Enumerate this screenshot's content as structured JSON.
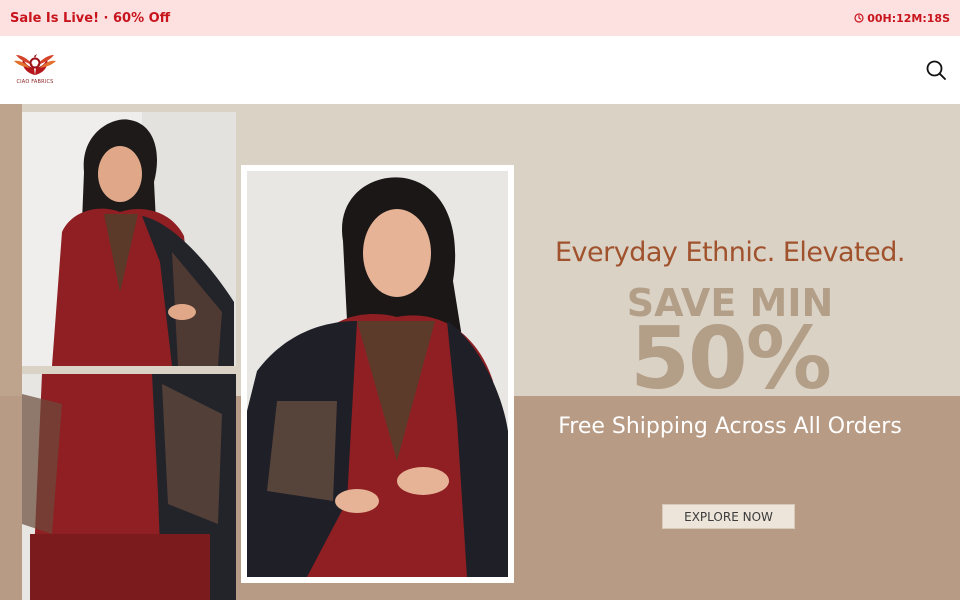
{
  "announcement": {
    "text": "Sale Is Live! · 60% Off",
    "timer": "00H:12M:18S",
    "timer_icon": "clock-icon",
    "accent": "#c8141c",
    "background": "#fde1e1"
  },
  "header": {
    "logo_text": "CIAO FABRICS",
    "search_icon": "search-icon"
  },
  "hero": {
    "tagline": "Everyday Ethnic. Elevated.",
    "save_label": "SAVE MIN",
    "percent": "50%",
    "shipping": "Free Shipping Across All Orders",
    "cta": "EXPLORE NOW",
    "colors": {
      "background": "#dbd2c6",
      "band": "#b89b84",
      "tagline": "#a0522d",
      "discount": "#b39f88"
    }
  }
}
